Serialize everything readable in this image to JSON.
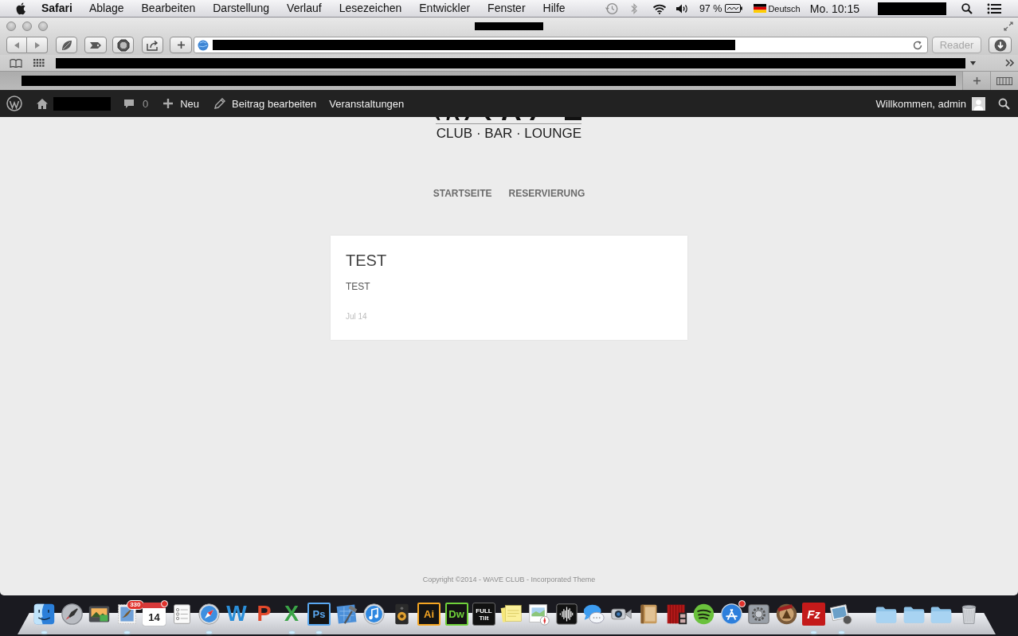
{
  "menu_bar": {
    "app_name": "Safari",
    "menus": [
      "Ablage",
      "Bearbeiten",
      "Darstellung",
      "Verlauf",
      "Lesezeichen",
      "Entwickler",
      "Fenster",
      "Hilfe"
    ],
    "battery": "97 %",
    "input_source": "Deutsch",
    "clock": "Mo. 10:15"
  },
  "browser": {
    "reader_button": {
      "label": "Reader",
      "disabled": true
    }
  },
  "admin_bar": {
    "comments": "0",
    "items": [
      {
        "kind": "new",
        "label": "Neu"
      },
      {
        "kind": "edit",
        "label": "Beitrag bearbeiten"
      },
      {
        "kind": "plain",
        "label": "Veranstaltungen"
      }
    ],
    "greeting": "Willkommen, admin"
  },
  "site": {
    "tagline": "CLUB · BAR · LOUNGE",
    "nav": [
      {
        "label": "STARTSEITE"
      },
      {
        "label": "RESERVIERUNG"
      }
    ],
    "posts": [
      {
        "title": "TEST",
        "excerpt": "TEST",
        "date": "Jul 14"
      }
    ],
    "footer": "Copyright ©2014 - WAVE CLUB - Incorporated Theme"
  },
  "dock": {
    "apps": [
      {
        "kind": "face",
        "running": true,
        "alert": false
      },
      {
        "kind": "rocket",
        "running": false,
        "alert": false
      },
      {
        "kind": "photos",
        "running": false,
        "alert": false
      },
      {
        "kind": "stamp",
        "running": true,
        "alert": false,
        "badge": "330"
      },
      {
        "kind": "calendar",
        "running": false,
        "alert": true,
        "glyph": "14"
      },
      {
        "kind": "checklist",
        "running": false,
        "alert": false
      },
      {
        "kind": "compass",
        "running": true,
        "alert": false
      },
      {
        "kind": "letter",
        "running": false,
        "alert": false,
        "glyph": "W",
        "color": "#2b8ed8"
      },
      {
        "kind": "letter",
        "running": false,
        "alert": false,
        "glyph": "P",
        "color": "#e2492b"
      },
      {
        "kind": "letter",
        "running": true,
        "alert": false,
        "glyph": "X",
        "color": "#3aa447"
      },
      {
        "kind": "framed",
        "running": true,
        "alert": false,
        "glyph": "Ps",
        "color": "#5aa8f0"
      },
      {
        "kind": "blueprint",
        "running": false,
        "alert": false
      },
      {
        "kind": "music",
        "running": false,
        "alert": false
      },
      {
        "kind": "speaker",
        "running": false,
        "alert": false
      },
      {
        "kind": "framed",
        "running": false,
        "alert": false,
        "glyph": "Ai",
        "color": "#f5a623"
      },
      {
        "kind": "framed",
        "running": false,
        "alert": false,
        "glyph": "Dw",
        "color": "#6fd13a"
      },
      {
        "kind": "label",
        "running": false,
        "alert": false,
        "glyph": "FULL Tilt",
        "color": "#111111"
      },
      {
        "kind": "notes",
        "running": false,
        "alert": false
      },
      {
        "kind": "map",
        "running": false,
        "alert": false
      },
      {
        "kind": "waveform",
        "running": false,
        "alert": false
      },
      {
        "kind": "chat",
        "running": false,
        "alert": false
      },
      {
        "kind": "camera",
        "running": false,
        "alert": false
      },
      {
        "kind": "book",
        "running": false,
        "alert": false
      },
      {
        "kind": "curtain",
        "running": false,
        "alert": false
      },
      {
        "kind": "stripes",
        "running": false,
        "alert": false
      },
      {
        "kind": "store",
        "running": false,
        "alert": true
      },
      {
        "kind": "gear",
        "running": false,
        "alert": false
      },
      {
        "kind": "emblem",
        "running": false,
        "alert": false
      },
      {
        "kind": "filled",
        "running": true,
        "alert": false,
        "glyph": "Fz",
        "color": "#c41a1a"
      },
      {
        "kind": "snapshot",
        "running": true,
        "alert": false
      }
    ],
    "stacks": [
      {
        "kind": "folder"
      },
      {
        "kind": "folder"
      },
      {
        "kind": "folder"
      },
      {
        "kind": "trash"
      }
    ]
  }
}
